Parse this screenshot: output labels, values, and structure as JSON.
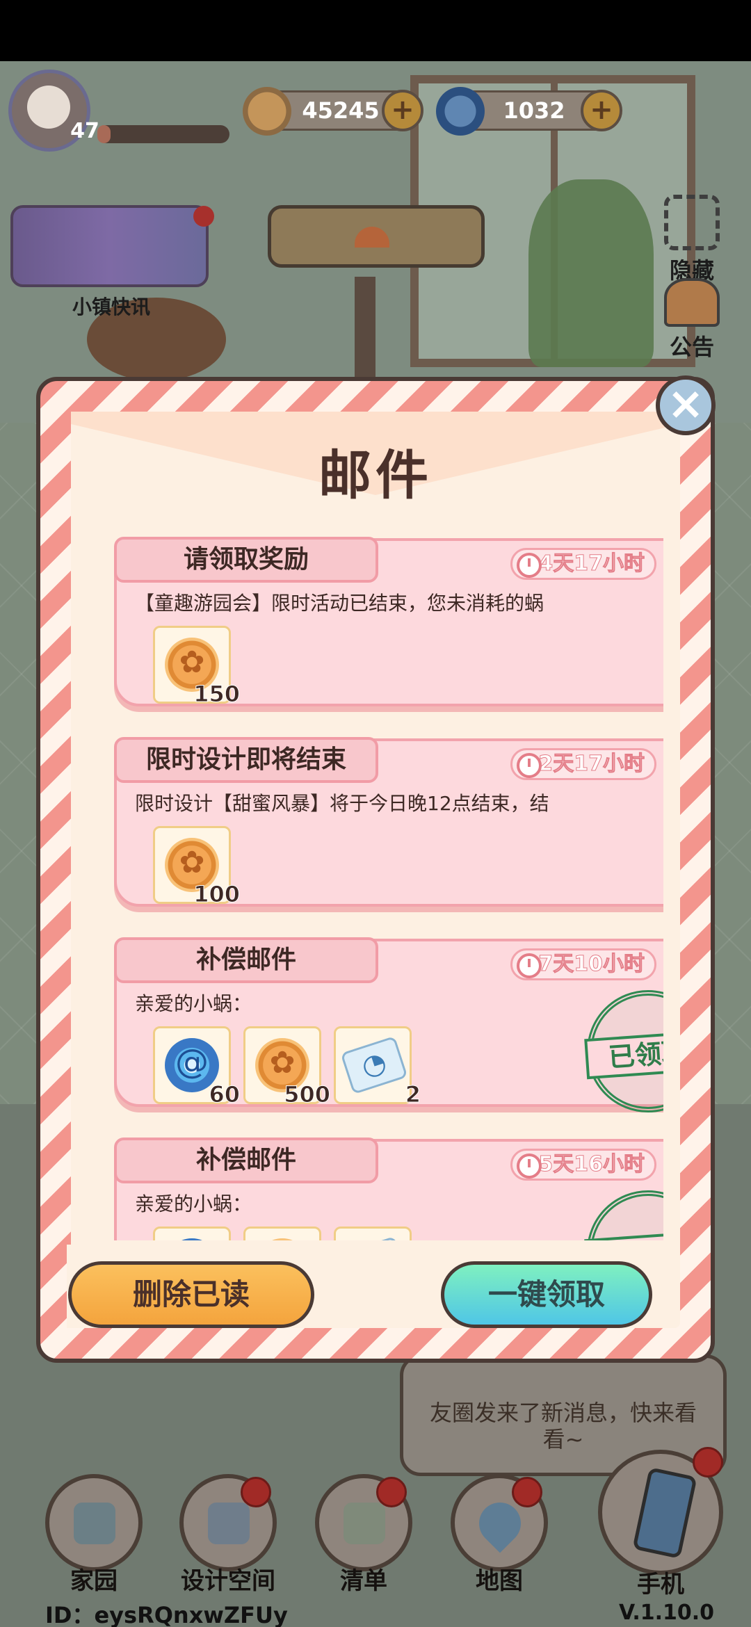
{
  "hud": {
    "level": "47",
    "xp_fraction": 0.1,
    "coins": "45245",
    "gems": "1032",
    "plus": "+"
  },
  "news": {
    "label": "小镇快讯"
  },
  "side": {
    "hide": "隐藏",
    "notice": "公告"
  },
  "background_bubble": "友圈发来了新消息，快来看看~",
  "dialog": {
    "title": "邮件",
    "close": "×",
    "claimed_stamp": "已领取",
    "delete_read": "删除已读",
    "claim_all": "一键领取"
  },
  "mails": [
    {
      "title": "请领取奖励",
      "timer": "4天17小时",
      "desc": "【童趣游园会】限时活动已结束，您未消耗的蜗",
      "unread": true,
      "rewards": [
        {
          "icon": "coin-icon",
          "qty": "150"
        }
      ]
    },
    {
      "title": "限时设计即将结束",
      "timer": "2天17小时",
      "desc": "限时设计【甜蜜风暴】将于今日晚12点结束，结",
      "unread": true,
      "rewards": [
        {
          "icon": "coin-icon",
          "qty": "100"
        }
      ]
    },
    {
      "title": "补偿邮件",
      "timer": "7天10小时",
      "desc": "亲爱的小蜗：",
      "claimed": true,
      "rewards": [
        {
          "icon": "gem-icon",
          "qty": "60"
        },
        {
          "icon": "coin-icon",
          "qty": "500"
        },
        {
          "icon": "ticket-icon",
          "qty": "2"
        }
      ]
    },
    {
      "title": "补偿邮件",
      "timer": "5天16小时",
      "desc": "亲爱的小蜗：",
      "claimed": true,
      "rewards": [
        {
          "icon": "gem-icon",
          "qty": ""
        },
        {
          "icon": "coin-icon",
          "qty": ""
        },
        {
          "icon": "ticket-icon",
          "qty": ""
        }
      ]
    }
  ],
  "nav": {
    "home": "家园",
    "design": "设计空间",
    "list": "清单",
    "map": "地图",
    "phone": "手机"
  },
  "footer": {
    "user_id": "ID：eysRQnxwZFUy",
    "version": "V.1.10.0"
  },
  "colors": {
    "dialog_stripe": "#f3958d",
    "card_bg": "#fdd9dd",
    "claimed_green": "#2f8a52",
    "delete_btn": "#f4a43d",
    "claim_btn": "#4fc6e6"
  }
}
